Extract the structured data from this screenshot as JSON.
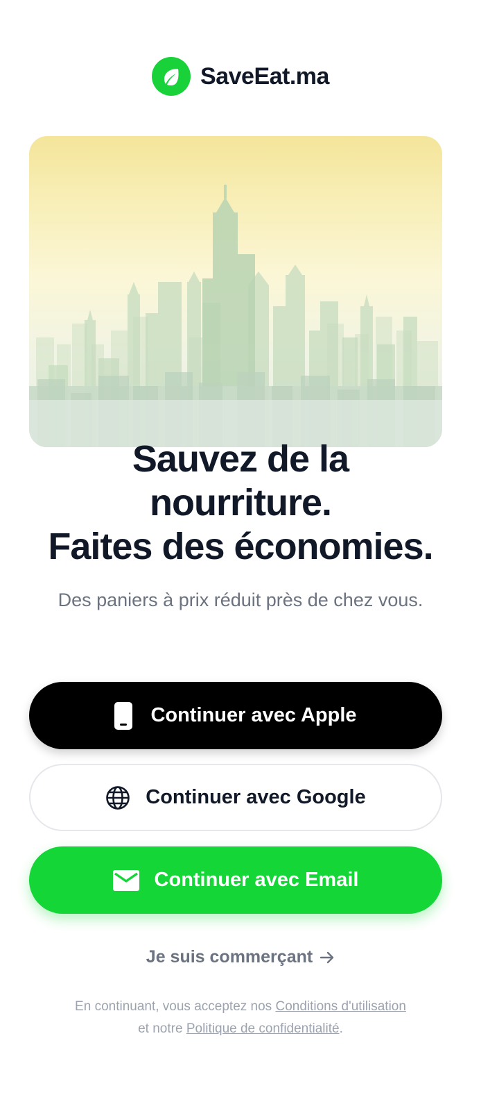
{
  "brand": {
    "name": "SaveEat.ma",
    "logo_icon": "leaf-icon",
    "color": "#19d23a"
  },
  "hero": {
    "image": "city-skyline-illustration"
  },
  "headline": {
    "line1": "Sauvez de la",
    "line2": "nourriture.",
    "line3": "Faites des économies."
  },
  "subhead": "Des paniers à prix réduit près de chez vous.",
  "auth": {
    "apple_label": "Continuer avec Apple",
    "apple_icon": "phone-icon",
    "google_label": "Continuer avec Google",
    "google_icon": "globe-icon",
    "email_label": "Continuer avec Email",
    "email_icon": "mail-icon"
  },
  "merchant_link": {
    "label": "Je suis commerçant",
    "icon": "arrow-right-icon"
  },
  "legal": {
    "prefix": "En continuant, vous acceptez nos",
    "terms": "Conditions d'utilisation",
    "middle": "et notre",
    "privacy": "Politique de confidentialité",
    "suffix": "."
  },
  "colors": {
    "accent": "#14d637",
    "text_primary": "#111827",
    "text_secondary": "#6b7280"
  }
}
